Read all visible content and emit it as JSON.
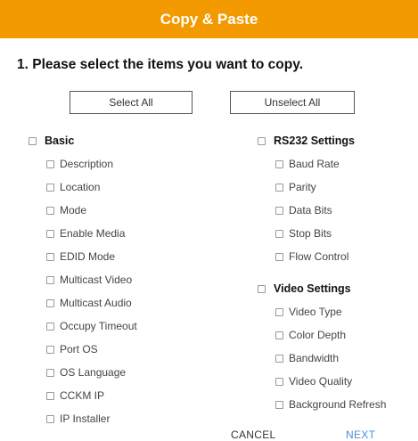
{
  "header": {
    "title": "Copy & Paste"
  },
  "step": {
    "heading": "1. Please select the items you want to copy."
  },
  "buttons": {
    "select_all": "Select All",
    "unselect_all": "Unselect All"
  },
  "groups": {
    "basic": {
      "label": "Basic",
      "items": [
        "Description",
        "Location",
        "Mode",
        "Enable Media",
        "EDID Mode",
        "Multicast Video",
        "Multicast Audio",
        "Occupy Timeout",
        "Port OS",
        "OS Language",
        "CCKM IP",
        "IP Installer"
      ]
    },
    "rs232": {
      "label": "RS232 Settings",
      "items": [
        "Baud Rate",
        "Parity",
        "Data Bits",
        "Stop Bits",
        "Flow Control"
      ]
    },
    "video": {
      "label": "Video Settings",
      "items": [
        "Video Type",
        "Color Depth",
        "Bandwidth",
        "Video Quality",
        "Background Refresh"
      ]
    }
  },
  "footer": {
    "cancel": "CANCEL",
    "next": "NEXT"
  },
  "colors": {
    "header_bg": "#f39a00",
    "next_link": "#4a90d9"
  }
}
